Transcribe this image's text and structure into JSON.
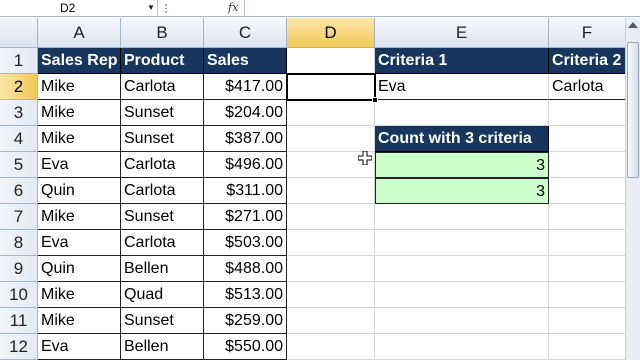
{
  "formula_bar": {
    "name_box": "D2",
    "fx_label": "fx",
    "formula": ""
  },
  "columns": [
    "A",
    "B",
    "C",
    "D",
    "E",
    "F"
  ],
  "rows": [
    "1",
    "2",
    "3",
    "4",
    "5",
    "6",
    "7",
    "8",
    "9",
    "10",
    "11",
    "12"
  ],
  "table": {
    "headers": [
      "Sales Rep",
      "Product",
      "Sales"
    ],
    "rows": [
      [
        "Mike",
        "Carlota",
        "$417.00"
      ],
      [
        "Mike",
        "Sunset",
        "$204.00"
      ],
      [
        "Mike",
        "Sunset",
        "$387.00"
      ],
      [
        "Eva",
        "Carlota",
        "$496.00"
      ],
      [
        "Quin",
        "Carlota",
        "$311.00"
      ],
      [
        "Mike",
        "Sunset",
        "$271.00"
      ],
      [
        "Eva",
        "Carlota",
        "$503.00"
      ],
      [
        "Quin",
        "Bellen",
        "$488.00"
      ],
      [
        "Mike",
        "Quad",
        "$513.00"
      ],
      [
        "Mike",
        "Sunset",
        "$259.00"
      ],
      [
        "Eva",
        "Bellen",
        "$550.00"
      ]
    ]
  },
  "criteria": {
    "e_header": "Criteria 1",
    "f_header": "Criteria 2",
    "e_value": "Eva",
    "f_value": "Carlota"
  },
  "count_box": {
    "header": "Count with 3 criteria",
    "values": [
      "3",
      "3"
    ]
  },
  "active_cell": "D2",
  "colors": {
    "header_bg": "#17365d",
    "header_text": "#ffffff",
    "result_bg": "#ccffcc",
    "active_header": "#f4c85a"
  }
}
